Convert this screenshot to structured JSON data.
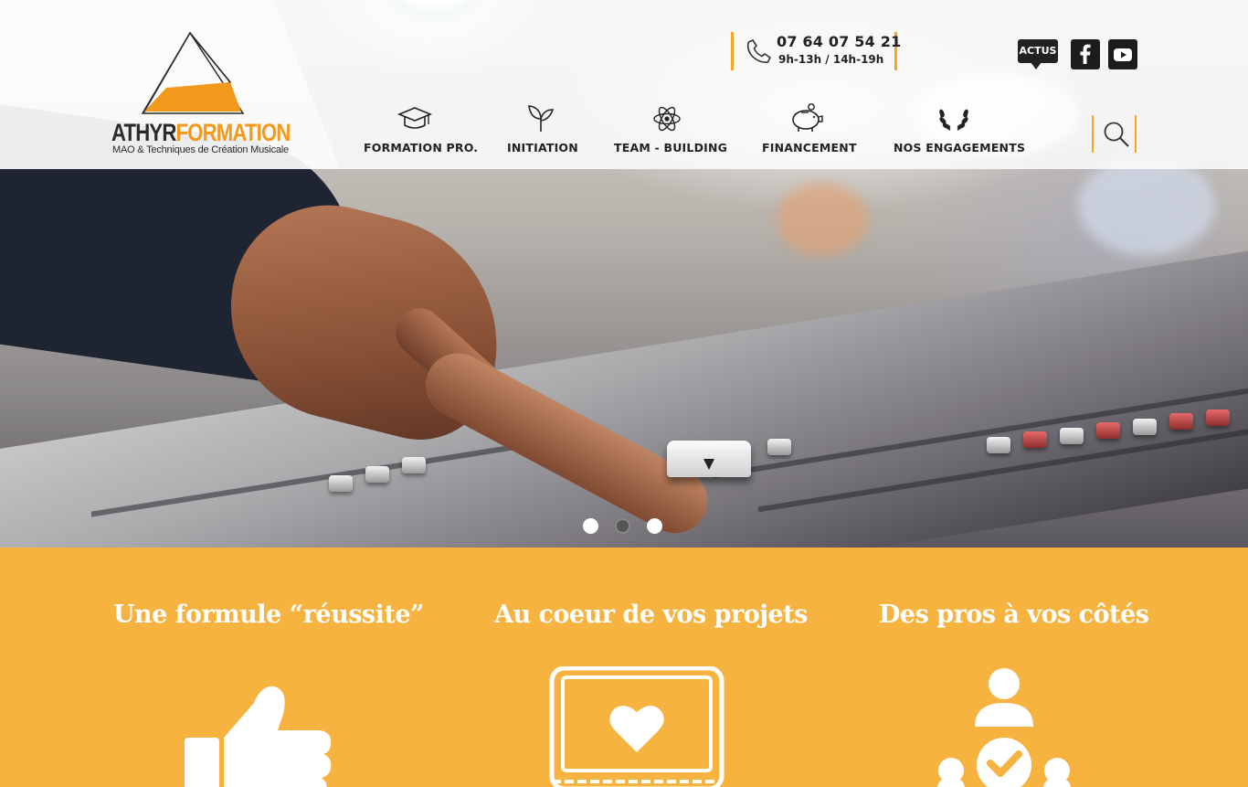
{
  "brand": {
    "name_part1": "ATHYR",
    "name_part2": "FORMATION",
    "tagline": "MAO & Techniques de Création Musicale",
    "accent_color": "#f6a623",
    "section_bg": "#f7b33f"
  },
  "contact": {
    "phone": "07 64 07 54 21",
    "hours": "9h-13h / 14h-19h",
    "icon": "phone-icon"
  },
  "top_links": {
    "actus_label": "ACTUS",
    "facebook_icon": "facebook-icon",
    "youtube_icon": "youtube-icon"
  },
  "nav": {
    "items": [
      {
        "label": "FORMATION PRO.",
        "icon": "graduation-cap-icon"
      },
      {
        "label": "INITIATION",
        "icon": "sprout-icon"
      },
      {
        "label": "TEAM - BUILDING",
        "icon": "atom-icon"
      },
      {
        "label": "FINANCEMENT",
        "icon": "piggy-bank-icon"
      },
      {
        "label": "NOS ENGAGEMENTS",
        "icon": "laurel-icon"
      }
    ],
    "search_icon": "search-icon"
  },
  "slider": {
    "slide_count": 3,
    "active_index": 1
  },
  "features": [
    {
      "title": "Une formule “réussite”",
      "icon": "thumbs-up-icon"
    },
    {
      "title": "Au coeur de vos projets",
      "icon": "laptop-heart-icon"
    },
    {
      "title": "Des pros à vos côtés",
      "icon": "team-check-icon"
    }
  ]
}
